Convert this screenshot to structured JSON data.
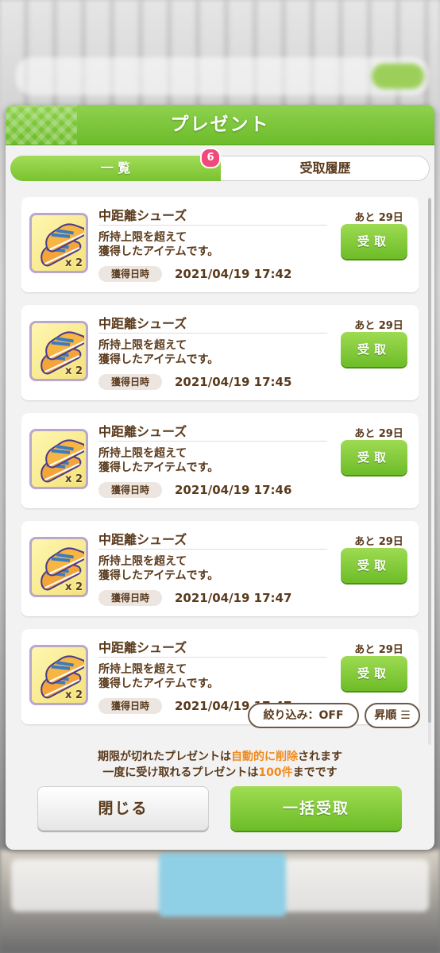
{
  "dialog": {
    "title": "プレゼント"
  },
  "tabs": [
    {
      "label": "一 覧",
      "active": true
    },
    {
      "label": "受取履歴",
      "active": false
    }
  ],
  "badge_count": "6",
  "item_icon": "shoes-icon",
  "items": [
    {
      "name": "中距離シューズ",
      "qty": "x 2",
      "desc1": "所持上限を超えて",
      "desc2": "獲得したアイテムです。",
      "date_label": "獲得日時",
      "date": "2021/04/19 17:42",
      "expire": "あと 29日",
      "button": "受取"
    },
    {
      "name": "中距離シューズ",
      "qty": "x 2",
      "desc1": "所持上限を超えて",
      "desc2": "獲得したアイテムです。",
      "date_label": "獲得日時",
      "date": "2021/04/19 17:45",
      "expire": "あと 29日",
      "button": "受取"
    },
    {
      "name": "中距離シューズ",
      "qty": "x 2",
      "desc1": "所持上限を超えて",
      "desc2": "獲得したアイテムです。",
      "date_label": "獲得日時",
      "date": "2021/04/19 17:46",
      "expire": "あと 29日",
      "button": "受取"
    },
    {
      "name": "中距離シューズ",
      "qty": "x 2",
      "desc1": "所持上限を超えて",
      "desc2": "獲得したアイテムです。",
      "date_label": "獲得日時",
      "date": "2021/04/19 17:47",
      "expire": "あと 29日",
      "button": "受取"
    },
    {
      "name": "中距離シューズ",
      "qty": "x 2",
      "desc1": "所持上限を超えて",
      "desc2": "獲得したアイテムです。",
      "date_label": "獲得日時",
      "date": "2021/04/19 17:47",
      "expire": "あと 29日",
      "button": "受取"
    }
  ],
  "filter": {
    "label": "絞り込み：OFF"
  },
  "sort": {
    "label": "昇順"
  },
  "notes": {
    "line1_a": "期限が切れたプレゼントは",
    "line1_b": "自動的に削除",
    "line1_c": "されます",
    "line2_a": "一度に受け取れるプレゼントは",
    "line2_b": "100件",
    "line2_c": "までです"
  },
  "buttons": {
    "close": "閉じる",
    "bulk": "一括受取"
  },
  "colors": {
    "accent_green": "#7cc431",
    "text_brown": "#5a3a1c",
    "highlight_orange": "#f08a1c",
    "badge_pink": "#f04a7a"
  }
}
